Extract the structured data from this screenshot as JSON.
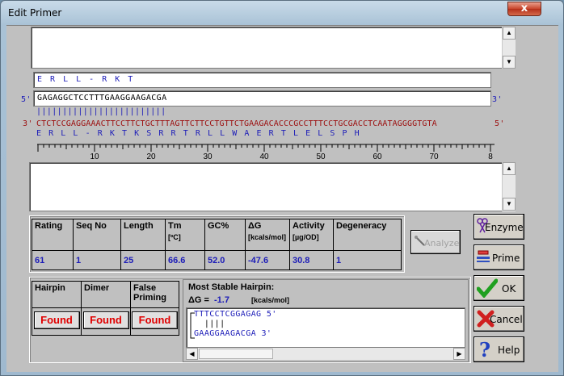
{
  "window": {
    "title": "Edit Primer",
    "close_label": "x"
  },
  "sequence": {
    "protein_top": "E  R  L  L  -  R  K  T",
    "five_prime_label": "5'",
    "three_prime_label": "3'",
    "primer_seq": "GAGAGGCTCCTTTGAAGGAAGACGA",
    "match_bars": "|||||||||||||||||||||||||",
    "template_five": "3'",
    "template_seq": "CTCTCCGAGGAAACTTCCTTCTGCTTTAGTTCTTCCTGTTCTGAAGACACCCGCCTTTCCTGCGACCTCAATAGGGGTGTA",
    "template_three": "5'",
    "protein_bottom": "E  R  L  L  -  R  K  T  K  S  R  R  T  R  L  L  W  A  E  R  T  L  E  L  S  P  H"
  },
  "ruler": {
    "ticks": [
      "10",
      "20",
      "30",
      "40",
      "50",
      "60",
      "70",
      "8"
    ]
  },
  "stats": {
    "headers": [
      {
        "label": "Rating",
        "sub": ""
      },
      {
        "label": "Seq No",
        "sub": ""
      },
      {
        "label": "Length",
        "sub": ""
      },
      {
        "label": "Tm",
        "sub": "[ºC]"
      },
      {
        "label": "GC%",
        "sub": ""
      },
      {
        "label": "ΔG",
        "sub": "[kcals/mol]"
      },
      {
        "label": "Activity",
        "sub": "[µg/OD]"
      },
      {
        "label": "Degeneracy",
        "sub": ""
      }
    ],
    "values": [
      "61",
      "1",
      "25",
      "66.6",
      "52.0",
      "-47.6",
      "30.8",
      "1"
    ]
  },
  "analyze_label": "Analyze",
  "checks": {
    "hairpin_label": "Hairpin",
    "dimer_label": "Dimer",
    "false_priming_label": "False Priming",
    "hairpin_status": "Found",
    "dimer_status": "Found",
    "false_priming_status": "Found"
  },
  "hairpin_panel": {
    "title": "Most Stable Hairpin:",
    "dg_label": "ΔG =",
    "dg_value": "-1.7",
    "dg_unit": "[kcals/mol]",
    "line1": "TTTCCTCGGAGAG 5'",
    "line2": "  ||||",
    "line3": "GAAGGAAGACGA 3'"
  },
  "buttons": {
    "enzyme": "Enzyme",
    "prime": "Prime",
    "ok": "OK",
    "cancel": "Cancel",
    "help": "Help"
  },
  "colors": {
    "sequence_blue": "#1c1cb8",
    "template_red": "#9c1010",
    "found_red": "#e00000"
  }
}
